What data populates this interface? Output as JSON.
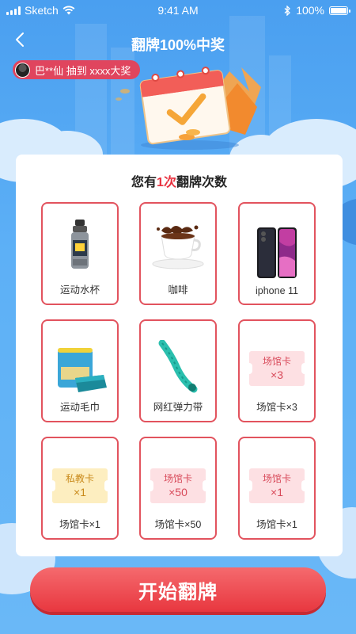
{
  "status": {
    "carrier": "Sketch",
    "time": "9:41 AM",
    "battery": "100%"
  },
  "nav": {
    "title": "翻牌100%中奖"
  },
  "ticker": {
    "text": "巴**仙 抽到 xxxx大奖"
  },
  "card": {
    "title_prefix": "您有",
    "title_count": "1次",
    "title_suffix": "翻牌次数"
  },
  "prizes": [
    {
      "label": "运动水杯",
      "icon": "water-bottle-icon"
    },
    {
      "label": "咖啡",
      "icon": "coffee-cup-icon"
    },
    {
      "label": "iphone 11",
      "icon": "iphone-icon"
    },
    {
      "label": "运动毛巾",
      "icon": "towel-icon"
    },
    {
      "label": "网红弹力带",
      "icon": "resistance-band-icon"
    },
    {
      "label": "场馆卡×3",
      "ticket_name": "场馆卡",
      "ticket_value": "×3"
    },
    {
      "label": "场馆卡×1",
      "ticket_name": "私教卡",
      "ticket_value": "×1"
    },
    {
      "label": "场馆卡×50",
      "ticket_name": "场馆卡",
      "ticket_value": "×50"
    },
    {
      "label": "场馆卡×1",
      "ticket_name": "场馆卡",
      "ticket_value": "×1"
    }
  ],
  "cta": {
    "label": "开始翻牌"
  },
  "colors": {
    "accent": "#e8313f",
    "tile_border": "#e2535e",
    "background": "#5aa9f2"
  }
}
